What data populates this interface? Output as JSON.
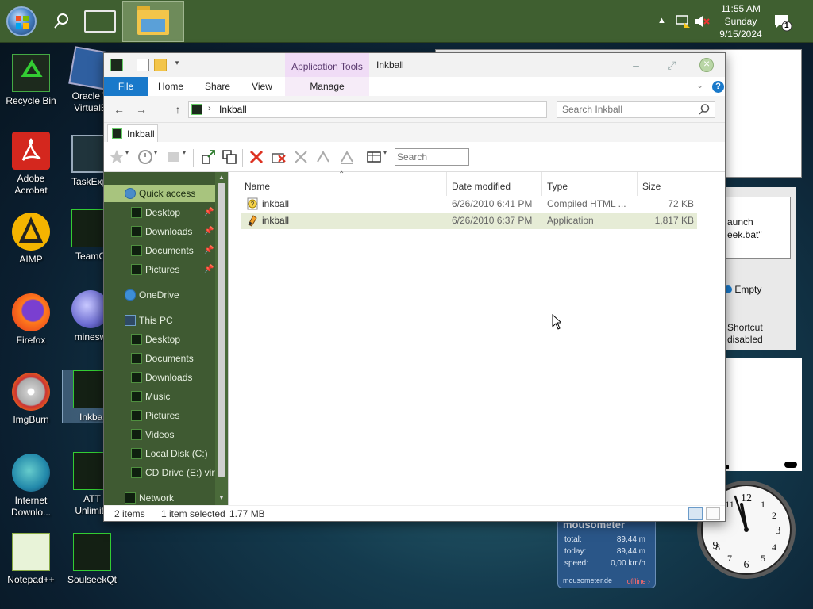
{
  "taskbar": {
    "time": "11:55 AM",
    "day": "Sunday",
    "date": "9/15/2024",
    "notification_count": "1"
  },
  "desktop_icons": [
    {
      "label": "Recycle Bin",
      "icon": "recycle-bin-icon"
    },
    {
      "label": "Oracle V\nVirtualB",
      "icon": "virtualbox-icon"
    },
    {
      "label": "Adobe\nAcrobat",
      "icon": "acrobat-icon"
    },
    {
      "label": "TaskExpl",
      "icon": "task-explorer-icon"
    },
    {
      "label": "AIMP",
      "icon": "aimp-icon"
    },
    {
      "label": "TeamC",
      "icon": "teamc-icon"
    },
    {
      "label": "Firefox",
      "icon": "firefox-icon"
    },
    {
      "label": "minesw",
      "icon": "minesweeper-icon"
    },
    {
      "label": "ImgBurn",
      "icon": "imgburn-icon"
    },
    {
      "label": "Inkbal",
      "icon": "inkball-icon"
    },
    {
      "label": "Internet\nDownlo...",
      "icon": "internet-download-icon"
    },
    {
      "label": "ATT\nUnlimite",
      "icon": "att-icon"
    },
    {
      "label": "Notepad++",
      "icon": "notepadpp-icon"
    },
    {
      "label": "SoulseekQt",
      "icon": "soulseek-icon"
    }
  ],
  "background_windows": {
    "launch_line1": "aunch",
    "launch_line2": "eek.bat\"",
    "empty_label": "Empty",
    "shortcut_line1": "Shortcut",
    "shortcut_line2": "disabled"
  },
  "mousometer": {
    "title": "mousometer",
    "total_label": "total:",
    "total_value": "89,44 m",
    "today_label": "today:",
    "today_value": "89,44 m",
    "speed_label": "speed:",
    "speed_value": "0,00 km/h",
    "site": "mousometer.de",
    "status": "offline ›"
  },
  "clock_gadget": {
    "numbers": [
      "12",
      "3",
      "6",
      "9",
      "1",
      "2",
      "4",
      "5",
      "7",
      "8",
      "10",
      "11"
    ]
  },
  "explorer": {
    "window_title": "Inkball",
    "contextual_tab": "Application Tools",
    "ribbon_tabs": [
      "File",
      "Home",
      "Share",
      "View"
    ],
    "manage_tab": "Manage",
    "address_path": "Inkball",
    "search_placeholder": "Search Inkball",
    "doc_tab": "Inkball",
    "toolbar_search_placeholder": "Search",
    "nav_items": {
      "quick_access": "Quick access",
      "qa_desktop": "Desktop",
      "qa_downloads": "Downloads",
      "qa_documents": "Documents",
      "qa_pictures": "Pictures",
      "onedrive": "OneDrive",
      "this_pc": "This PC",
      "pc_desktop": "Desktop",
      "pc_documents": "Documents",
      "pc_downloads": "Downloads",
      "pc_music": "Music",
      "pc_pictures": "Pictures",
      "pc_videos": "Videos",
      "local_disk": "Local Disk (C:)",
      "cd_drive": "CD Drive (E:) virt",
      "network": "Network"
    },
    "columns": {
      "name": "Name",
      "date_modified": "Date modified",
      "type": "Type",
      "size": "Size"
    },
    "files": [
      {
        "name": "inkball",
        "date": "6/26/2010 6:41 PM",
        "type": "Compiled HTML ...",
        "size": "72 KB",
        "icon": "chm-help-icon",
        "selected": false
      },
      {
        "name": "inkball",
        "date": "6/26/2010 6:37 PM",
        "type": "Application",
        "size": "1,817 KB",
        "icon": "application-icon",
        "selected": true
      }
    ],
    "status": {
      "item_count": "2 items",
      "selection": "1 item selected",
      "selection_size": "1.77 MB"
    }
  },
  "colors": {
    "taskbar": "#3f5f30",
    "nav_pane": "#3f5a32",
    "file_tab": "#1979ca",
    "contextual_tab": "#f0dcf6",
    "selected_row": "#e6ecd6"
  }
}
